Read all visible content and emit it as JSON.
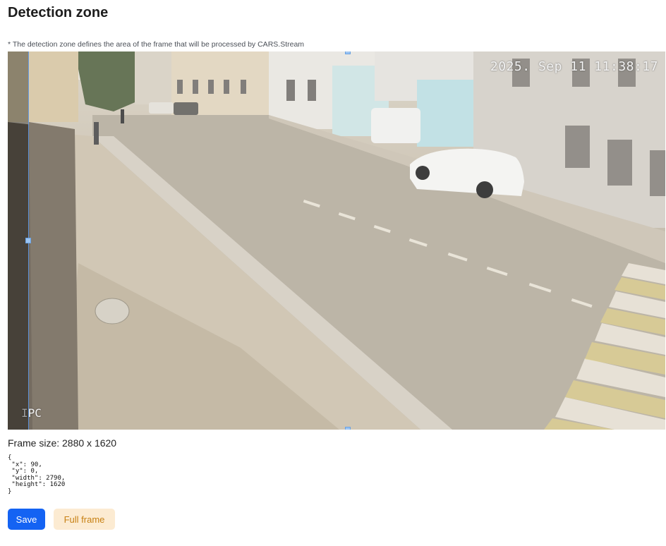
{
  "page": {
    "title": "Detection zone",
    "note": "* The detection zone defines the area of the frame that will be processed by CARS.Stream"
  },
  "video": {
    "timestamp": "2025. Sep 11 11:38:17",
    "channel_label": "IPC"
  },
  "frame_size": {
    "text": "Frame size: 2880 x 1620"
  },
  "zone_json": {
    "text": "{\n \"x\": 90,\n \"y\": 0,\n \"width\": 2790,\n \"height\": 1620\n}"
  },
  "buttons": {
    "save": "Save",
    "full_frame": "Full frame"
  },
  "colors": {
    "primary": "#1463f3",
    "secondary_bg": "#fcebd2",
    "secondary_text": "#c78013",
    "handle": "#9cc4f2"
  }
}
